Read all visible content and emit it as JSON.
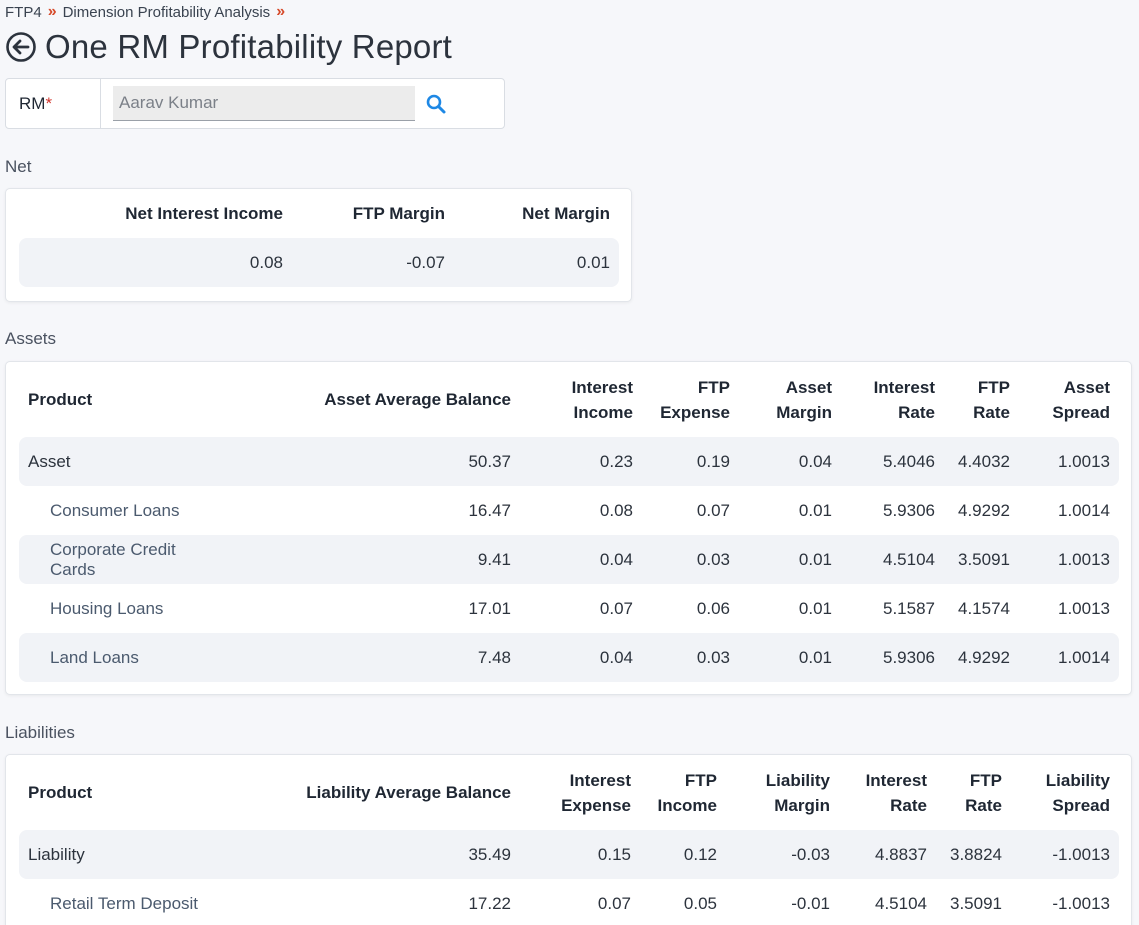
{
  "breadcrumb": [
    "FTP4",
    "Dimension Profitability Analysis"
  ],
  "page_title": "One RM Profitability Report",
  "rm": {
    "label": "RM",
    "required_mark": "*",
    "value": "Aarav Kumar"
  },
  "net": {
    "section_label": "Net",
    "headers": [
      "Net Interest Income",
      "FTP Margin",
      "Net Margin"
    ],
    "values": [
      "0.08",
      "-0.07",
      "0.01"
    ]
  },
  "assets": {
    "section_label": "Assets",
    "headers": {
      "product": "Product",
      "avg_balance": "Asset Average Balance",
      "interest_income": [
        "Interest",
        "Income"
      ],
      "ftp_expense": [
        "FTP",
        "Expense"
      ],
      "margin": [
        "Asset",
        "Margin"
      ],
      "interest_rate": [
        "Interest",
        "Rate"
      ],
      "ftp_rate": [
        "FTP",
        "Rate"
      ],
      "spread": [
        "Asset",
        "Spread"
      ]
    },
    "rows": [
      {
        "product": "Asset",
        "avg_balance": "50.37",
        "interest": "0.23",
        "ftp": "0.19",
        "margin": "0.04",
        "interest_rate": "5.4046",
        "ftp_rate": "4.4032",
        "spread": "1.0013"
      },
      {
        "product": "Consumer Loans",
        "avg_balance": "16.47",
        "interest": "0.08",
        "ftp": "0.07",
        "margin": "0.01",
        "interest_rate": "5.9306",
        "ftp_rate": "4.9292",
        "spread": "1.0014"
      },
      {
        "product": "Corporate Credit Cards",
        "avg_balance": "9.41",
        "interest": "0.04",
        "ftp": "0.03",
        "margin": "0.01",
        "interest_rate": "4.5104",
        "ftp_rate": "3.5091",
        "spread": "1.0013"
      },
      {
        "product": "Housing Loans",
        "avg_balance": "17.01",
        "interest": "0.07",
        "ftp": "0.06",
        "margin": "0.01",
        "interest_rate": "5.1587",
        "ftp_rate": "4.1574",
        "spread": "1.0013"
      },
      {
        "product": "Land Loans",
        "avg_balance": "7.48",
        "interest": "0.04",
        "ftp": "0.03",
        "margin": "0.01",
        "interest_rate": "5.9306",
        "ftp_rate": "4.9292",
        "spread": "1.0014"
      }
    ]
  },
  "liabilities": {
    "section_label": "Liabilities",
    "headers": {
      "product": "Product",
      "avg_balance": "Liability Average Balance",
      "interest_expense": [
        "Interest",
        "Expense"
      ],
      "ftp_income": [
        "FTP",
        "Income"
      ],
      "margin": [
        "Liability",
        "Margin"
      ],
      "interest_rate": [
        "Interest",
        "Rate"
      ],
      "ftp_rate": [
        "FTP",
        "Rate"
      ],
      "spread": [
        "Liability",
        "Spread"
      ]
    },
    "rows": [
      {
        "product": "Liability",
        "avg_balance": "35.49",
        "interest": "0.15",
        "ftp": "0.12",
        "margin": "-0.03",
        "interest_rate": "4.8837",
        "ftp_rate": "3.8824",
        "spread": "-1.0013"
      },
      {
        "product": "Retail Term Deposit",
        "avg_balance": "17.22",
        "interest": "0.07",
        "ftp": "0.05",
        "margin": "-0.01",
        "interest_rate": "4.5104",
        "ftp_rate": "3.5091",
        "spread": "-1.0013"
      }
    ]
  }
}
